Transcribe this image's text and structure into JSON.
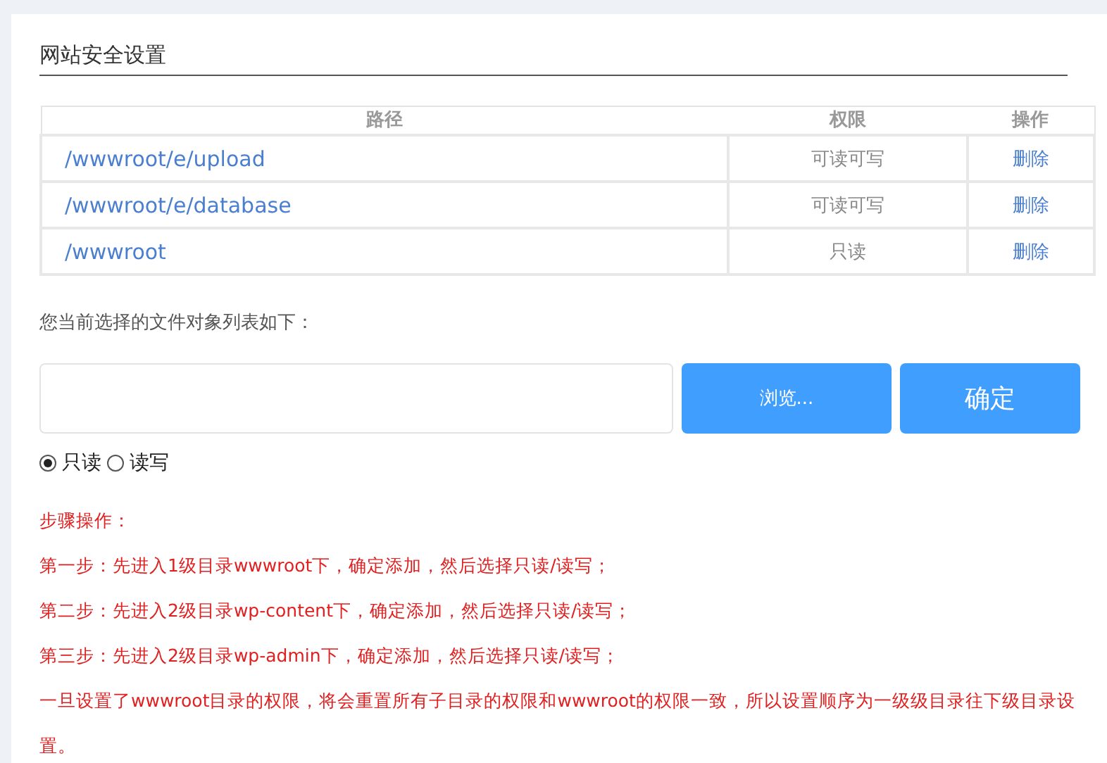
{
  "title": "网站安全设置",
  "table": {
    "columns": [
      "路径",
      "权限",
      "操作"
    ],
    "rows": [
      {
        "path": "/wwwroot/e/upload",
        "permission": "可读可写",
        "action": "删除"
      },
      {
        "path": "/wwwroot/e/database",
        "permission": "可读可写",
        "action": "删除"
      },
      {
        "path": "/wwwroot",
        "permission": "只读",
        "action": "删除"
      }
    ]
  },
  "selection_label": "您当前选择的文件对象列表如下：",
  "browse_button": "浏览...",
  "confirm_button": "确定",
  "modes": [
    {
      "label": "只读",
      "selected": true
    },
    {
      "label": "读写",
      "selected": false
    }
  ],
  "notes": [
    "步骤操作：",
    "第一步：先进入1级目录wwwroot下，确定添加，然后选择只读/读写；",
    "第二步：先进入2级目录wp-content下，确定添加，然后选择只读/读写；",
    "第三步：先进入2级目录wp-admin下，确定添加，然后选择只读/读写；",
    "一旦设置了wwwroot目录的权限，将会重置所有子目录的权限和wwwroot的权限一致，所以设置顺序为一级级目录往下级目录设置。"
  ]
}
